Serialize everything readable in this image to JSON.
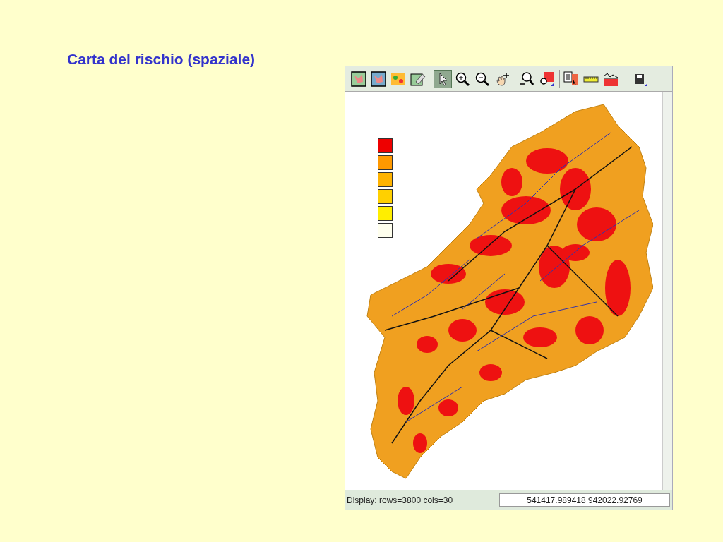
{
  "slide": {
    "title": "Carta del rischio (spaziale)"
  },
  "toolbar": {
    "groups": [
      [
        {
          "kind": "map",
          "selected": false
        },
        {
          "kind": "map2",
          "selected": false
        },
        {
          "kind": "raster",
          "selected": false
        },
        {
          "kind": "erase",
          "selected": false
        }
      ],
      [
        {
          "kind": "pointer",
          "selected": true
        },
        {
          "kind": "zoomin",
          "selected": false
        },
        {
          "kind": "zoomout",
          "selected": false
        },
        {
          "kind": "pan",
          "selected": false
        }
      ],
      [
        {
          "kind": "zoomback",
          "selected": false
        },
        {
          "kind": "zoommenu",
          "selected": false
        }
      ],
      [
        {
          "kind": "query",
          "selected": false
        },
        {
          "kind": "measure",
          "selected": false
        },
        {
          "kind": "profile",
          "selected": false
        }
      ],
      [
        {
          "kind": "save",
          "selected": false
        }
      ]
    ]
  },
  "legend": [
    {
      "color": "#ee0000"
    },
    {
      "color": "#ff9900"
    },
    {
      "color": "#ffb300"
    },
    {
      "color": "#ffd000"
    },
    {
      "color": "#ffee00"
    },
    {
      "color": "#ffffee"
    }
  ],
  "status_bar": {
    "display": "Display: rows=3800 cols=30",
    "coordinates": "541417.989418 942022.92769"
  }
}
